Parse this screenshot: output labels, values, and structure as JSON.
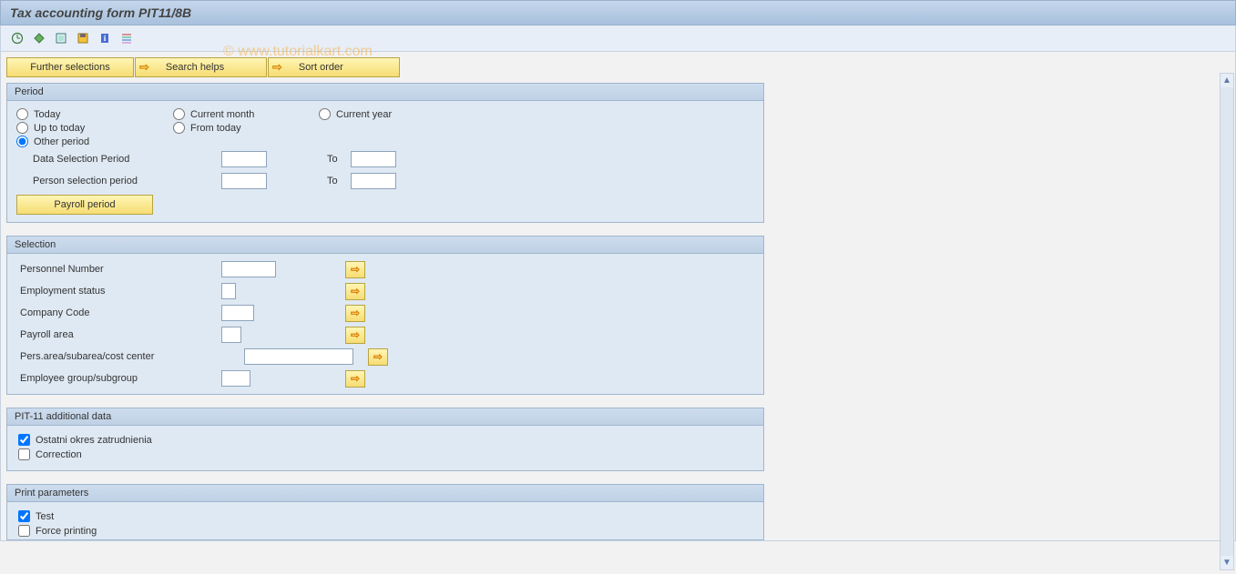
{
  "title": "Tax accounting form PIT11/8B",
  "watermark": "© www.tutorialkart.com",
  "buttons": {
    "further": "Further selections",
    "search": "Search helps",
    "sort": "Sort order",
    "payroll": "Payroll period"
  },
  "period": {
    "title": "Period",
    "today": "Today",
    "current_month": "Current month",
    "current_year": "Current year",
    "up_to_today": "Up to today",
    "from_today": "From today",
    "other_period": "Other period",
    "data_sel": "Data Selection Period",
    "person_sel": "Person selection period",
    "to": "To"
  },
  "selection": {
    "title": "Selection",
    "personnel": "Personnel Number",
    "emp_status": "Employment status",
    "company": "Company Code",
    "payroll_area": "Payroll area",
    "pers_area": "Pers.area/subarea/cost center",
    "emp_group": "Employee group/subgroup"
  },
  "pit11": {
    "title": "PIT-11 additional data",
    "ostatni": "Ostatni okres zatrudnienia",
    "correction": "Correction"
  },
  "print": {
    "title": "Print parameters",
    "test": "Test",
    "force": "Force printing"
  }
}
